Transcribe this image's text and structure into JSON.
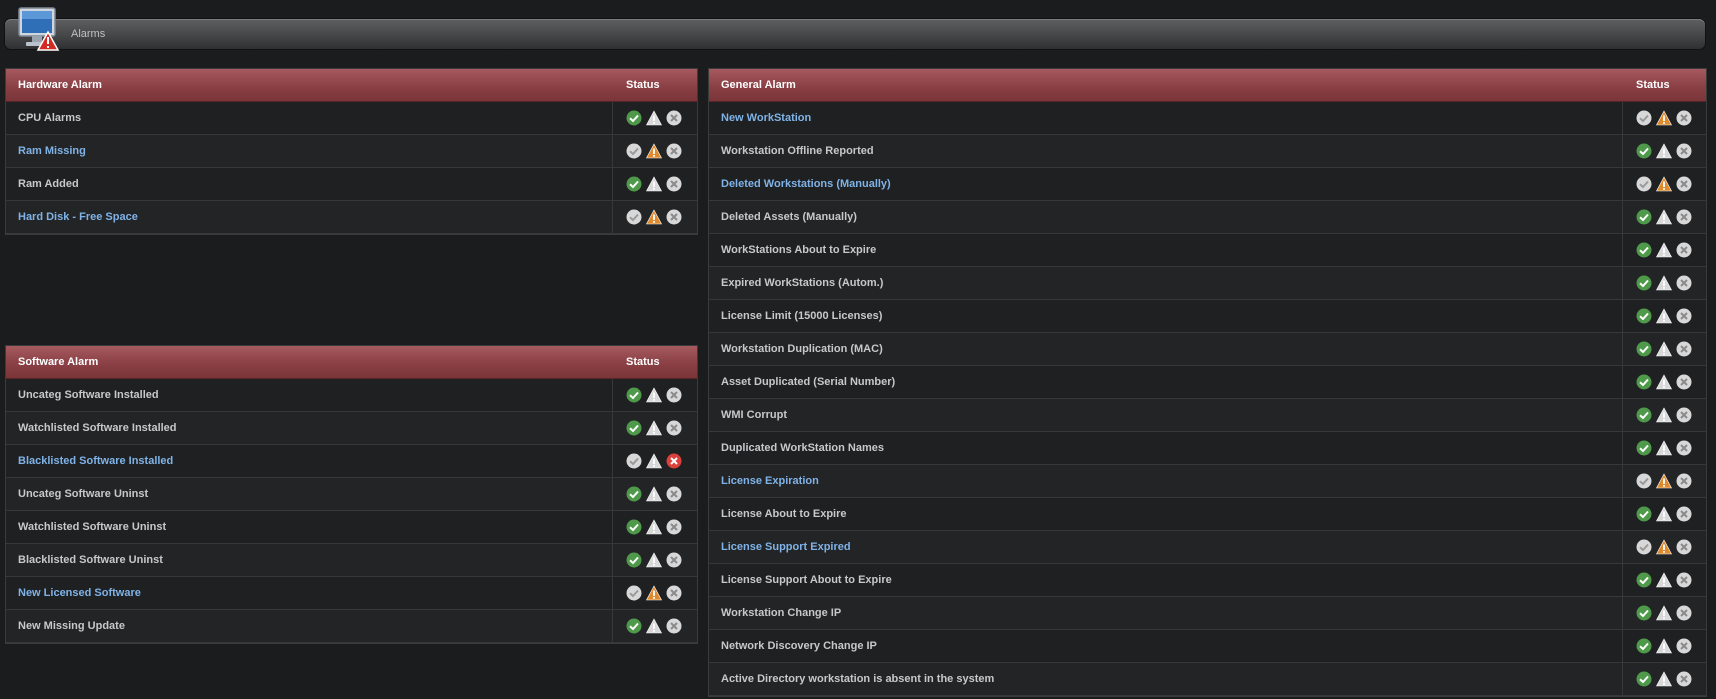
{
  "window": {
    "title": "Alarms"
  },
  "hardware": {
    "title": "Hardware Alarm",
    "status_label": "Status",
    "rows": [
      {
        "name": "CPU Alarms",
        "link": false,
        "ok": "green",
        "warn": "gray",
        "err": "gray"
      },
      {
        "name": "Ram Missing",
        "link": true,
        "ok": "gray",
        "warn": "orange",
        "err": "gray"
      },
      {
        "name": "Ram Added",
        "link": false,
        "ok": "green",
        "warn": "gray",
        "err": "gray"
      },
      {
        "name": "Hard Disk - Free Space",
        "link": true,
        "ok": "gray",
        "warn": "orange",
        "err": "gray"
      }
    ]
  },
  "software": {
    "title": "Software Alarm",
    "status_label": "Status",
    "rows": [
      {
        "name": "Uncateg Software Installed",
        "link": false,
        "ok": "green",
        "warn": "gray",
        "err": "gray"
      },
      {
        "name": "Watchlisted Software Installed",
        "link": false,
        "ok": "green",
        "warn": "gray",
        "err": "gray"
      },
      {
        "name": "Blacklisted Software Installed",
        "link": true,
        "ok": "gray",
        "warn": "gray",
        "err": "red"
      },
      {
        "name": "Uncateg Software Uninst",
        "link": false,
        "ok": "green",
        "warn": "gray",
        "err": "gray"
      },
      {
        "name": "Watchlisted Software Uninst",
        "link": false,
        "ok": "green",
        "warn": "gray",
        "err": "gray"
      },
      {
        "name": "Blacklisted Software Uninst",
        "link": false,
        "ok": "green",
        "warn": "gray",
        "err": "gray"
      },
      {
        "name": "New Licensed Software",
        "link": true,
        "ok": "gray",
        "warn": "orange",
        "err": "gray"
      },
      {
        "name": "New Missing Update",
        "link": false,
        "ok": "green",
        "warn": "gray",
        "err": "gray"
      }
    ]
  },
  "general": {
    "title": "General Alarm",
    "status_label": "Status",
    "rows": [
      {
        "name": "New WorkStation",
        "link": true,
        "ok": "gray",
        "warn": "orange",
        "err": "gray"
      },
      {
        "name": "Workstation Offline Reported",
        "link": false,
        "ok": "green",
        "warn": "gray",
        "err": "gray"
      },
      {
        "name": "Deleted Workstations (Manually)",
        "link": true,
        "ok": "gray",
        "warn": "orange",
        "err": "gray"
      },
      {
        "name": "Deleted Assets (Manually)",
        "link": false,
        "ok": "green",
        "warn": "gray",
        "err": "gray"
      },
      {
        "name": "WorkStations About to Expire",
        "link": false,
        "ok": "green",
        "warn": "gray",
        "err": "gray"
      },
      {
        "name": "Expired WorkStations (Autom.)",
        "link": false,
        "ok": "green",
        "warn": "gray",
        "err": "gray"
      },
      {
        "name": "License Limit (15000 Licenses)",
        "link": false,
        "ok": "green",
        "warn": "gray",
        "err": "gray"
      },
      {
        "name": "Workstation Duplication (MAC)",
        "link": false,
        "ok": "green",
        "warn": "gray",
        "err": "gray"
      },
      {
        "name": "Asset Duplicated (Serial Number)",
        "link": false,
        "ok": "green",
        "warn": "gray",
        "err": "gray"
      },
      {
        "name": "WMI Corrupt",
        "link": false,
        "ok": "green",
        "warn": "gray",
        "err": "gray"
      },
      {
        "name": "Duplicated WorkStation Names",
        "link": false,
        "ok": "green",
        "warn": "gray",
        "err": "gray"
      },
      {
        "name": "License Expiration",
        "link": true,
        "ok": "gray",
        "warn": "orange",
        "err": "gray"
      },
      {
        "name": "License About to Expire",
        "link": false,
        "ok": "green",
        "warn": "gray",
        "err": "gray"
      },
      {
        "name": "License Support Expired",
        "link": true,
        "ok": "gray",
        "warn": "orange",
        "err": "gray"
      },
      {
        "name": "License Support About to Expire",
        "link": false,
        "ok": "green",
        "warn": "gray",
        "err": "gray"
      },
      {
        "name": "Workstation Change IP",
        "link": false,
        "ok": "green",
        "warn": "gray",
        "err": "gray"
      },
      {
        "name": "Network Discovery Change IP",
        "link": false,
        "ok": "green",
        "warn": "gray",
        "err": "gray"
      },
      {
        "name": "Active Directory workstation is absent in the system",
        "link": false,
        "ok": "green",
        "warn": "gray",
        "err": "gray"
      }
    ]
  },
  "colors": {
    "header": "#8a4045",
    "link": "#7fb3e8",
    "text": "#c7c8ca",
    "green": "#4f9a4a",
    "orange": "#e08a2e",
    "red": "#d9413a",
    "gray": "#d8d8d8"
  },
  "icons": {
    "ok": "check-circle-icon",
    "warn": "warning-triangle-icon",
    "err": "close-circle-icon",
    "app": "monitor-alarm-icon"
  }
}
